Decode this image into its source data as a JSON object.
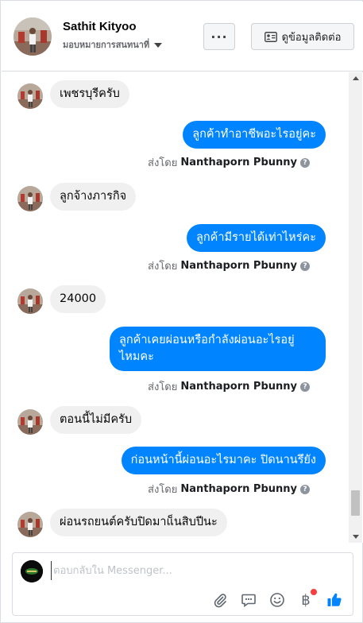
{
  "header": {
    "name": "Sathit Kityoo",
    "assign_label": "มอบหมายการสนทนาที่",
    "more_label": "···",
    "contact_label": "ดูข้อมูลติดต่อ"
  },
  "messages": [
    {
      "dir": "in",
      "text": "เพชรบุรีครับ"
    },
    {
      "dir": "out",
      "text": "ลูกค้าทำอาชีพอะไรอยู่คะ",
      "sent_by_prefix": "ส่งโดย",
      "sent_by_name": "Nanthaporn Pbunny"
    },
    {
      "dir": "in",
      "text": "ลูกจ้างภารกิจ"
    },
    {
      "dir": "out",
      "text": "ลูกค้ามีรายได้เท่าไหร่คะ",
      "sent_by_prefix": "ส่งโดย",
      "sent_by_name": "Nanthaporn Pbunny"
    },
    {
      "dir": "in",
      "text": "24000"
    },
    {
      "dir": "out",
      "text_line1": "ลูกค้าเคยผ่อนหรือกำลังผ่อนอะไรอยู่",
      "text_line2": "ไหมคะ",
      "sent_by_prefix": "ส่งโดย",
      "sent_by_name": "Nanthaporn Pbunny"
    },
    {
      "dir": "in",
      "text": "ตอนนี้ไม่มีครับ"
    },
    {
      "dir": "out",
      "text": "ก่อนหน้านี้ผ่อนอะไรมาคะ ปิดนานรึยัง",
      "sent_by_prefix": "ส่งโดย",
      "sent_by_name": "Nanthaporn Pbunny"
    },
    {
      "dir": "in",
      "text": "ผ่อนรถยนต์ครับปิดมาแ็นสิบปีนะ"
    }
  ],
  "composer": {
    "placeholder": "ตอบกลับใน Messenger..."
  },
  "icons": {
    "attach": "paperclip-icon",
    "saved_replies": "chat-bubble-icon",
    "emoji": "smiley-icon",
    "payment": "baht-icon",
    "like": "thumbs-up-icon"
  },
  "colors": {
    "outgoing_bubble": "#0084ff",
    "incoming_bubble": "#f0f0f0",
    "like_icon": "#0084ff",
    "notification_dot": "#fa3e3e"
  }
}
